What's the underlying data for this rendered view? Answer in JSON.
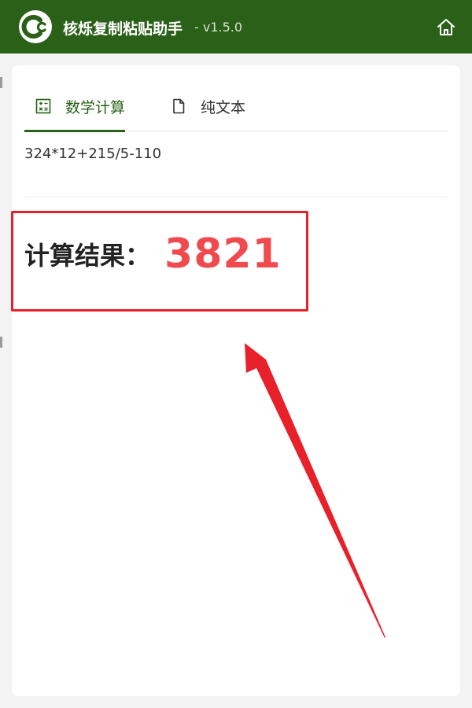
{
  "app": {
    "title": "核烁复制粘贴助手",
    "version": "- v1.5.0",
    "logo_icon": "c-logo-icon",
    "home_icon": "home-icon",
    "accent_color": "#2a6017"
  },
  "tabs": [
    {
      "label": "数学计算",
      "icon": "calculator-icon",
      "active": true
    },
    {
      "label": "纯文本",
      "icon": "document-icon",
      "active": false
    }
  ],
  "input": {
    "expression": "324*12+215/5-110"
  },
  "result": {
    "label": "计算结果：",
    "value": "3821",
    "value_color": "#f04a4f"
  },
  "annotation": {
    "box_color": "#e8202a",
    "arrow_color": "#e8202a"
  }
}
